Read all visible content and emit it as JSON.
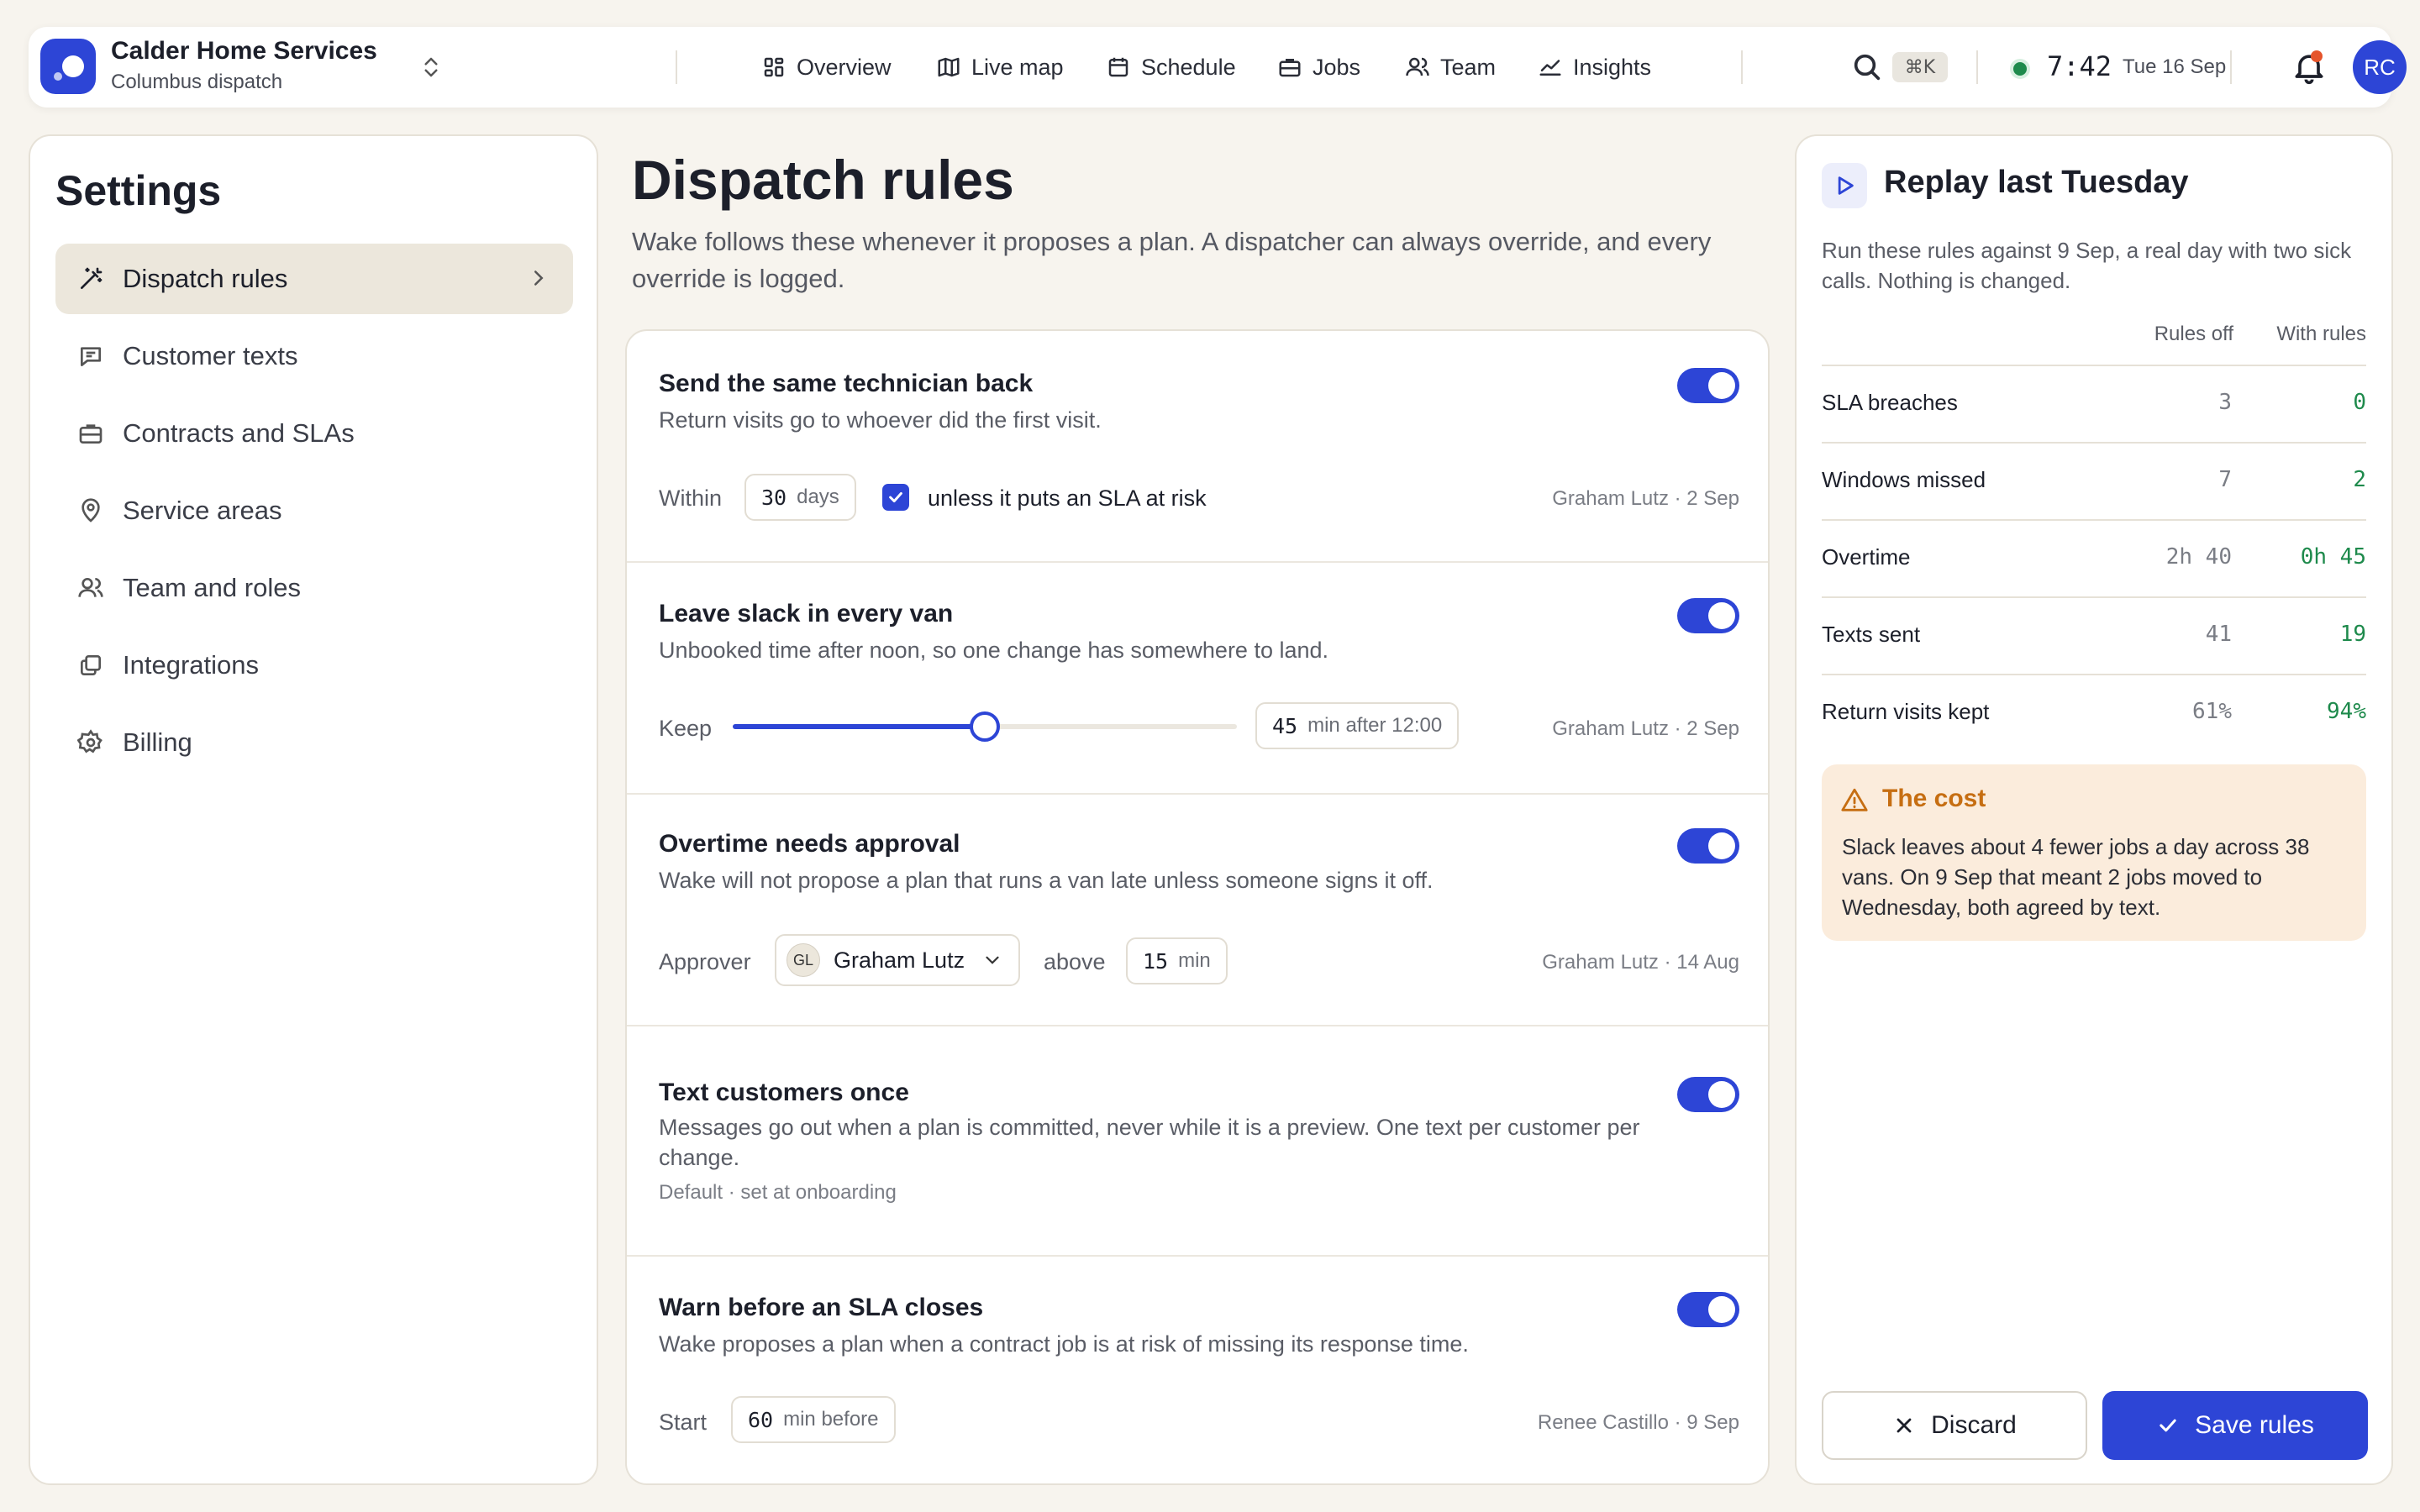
{
  "app": {
    "name": "Calder Home Services",
    "workspace": "Columbus dispatch",
    "nav": [
      {
        "label": "Overview",
        "icon": "grid-icon"
      },
      {
        "label": "Live map",
        "icon": "map-icon"
      },
      {
        "label": "Schedule",
        "icon": "calendar-icon"
      },
      {
        "label": "Jobs",
        "icon": "briefcase-icon"
      },
      {
        "label": "Team",
        "icon": "people-icon"
      },
      {
        "label": "Insights",
        "icon": "trend-icon"
      }
    ],
    "shortcut": "⌘K",
    "clock": "7:42",
    "date": "Tue 16 Sep",
    "user_initials": "RC",
    "accent": "#2d45d6",
    "status_color": "#1e8a4c"
  },
  "sidebar": {
    "title": "Settings",
    "items": [
      {
        "label": "Dispatch rules",
        "icon": "wand-icon",
        "active": true
      },
      {
        "label": "Customer texts",
        "icon": "message-icon"
      },
      {
        "label": "Contracts and SLAs",
        "icon": "briefcase-icon"
      },
      {
        "label": "Service areas",
        "icon": "pin-icon"
      },
      {
        "label": "Team and roles",
        "icon": "people-icon"
      },
      {
        "label": "Integrations",
        "icon": "layers-icon"
      },
      {
        "label": "Billing",
        "icon": "gear-icon"
      }
    ]
  },
  "main": {
    "title": "Dispatch rules",
    "subtitle": "Wake follows these whenever it proposes a plan. A dispatcher can always override, and every override is logged.",
    "rules": [
      {
        "title": "Send the same technician back",
        "desc": "Return visits go to whoever did the first visit.",
        "enabled": true,
        "control_label": "Within",
        "value": "30",
        "unit": "days",
        "checkbox_label": "unless it puts an SLA at risk",
        "checkbox_checked": true,
        "attribution": "Graham Lutz · 2 Sep"
      },
      {
        "title": "Leave slack in every van",
        "desc": "Unbooked time after noon, so one change has somewhere to land.",
        "enabled": true,
        "control_label": "Keep",
        "slider_fraction": 0.5,
        "value": "45",
        "unit": "min after 12:00",
        "attribution": "Graham Lutz · 2 Sep"
      },
      {
        "title": "Overtime needs approval",
        "desc": "Wake will not propose a plan that runs a van late unless someone signs it off.",
        "enabled": true,
        "control_label": "Approver",
        "approver_initials": "GL",
        "approver_name": "Graham Lutz",
        "threshold_label": "above",
        "value": "15",
        "unit": "min",
        "attribution": "Graham Lutz · 14 Aug"
      },
      {
        "title": "Text customers once",
        "desc": "Messages go out when a plan is committed, never while it is a preview. One text per customer per change.",
        "enabled": true,
        "note": "Default · set at onboarding"
      },
      {
        "title": "Warn before an SLA closes",
        "desc": "Wake proposes a plan when a contract job is at risk of missing its response time.",
        "enabled": true,
        "control_label": "Start",
        "value": "60",
        "unit": "min before",
        "attribution": "Renee Castillo · 9 Sep"
      }
    ]
  },
  "replay": {
    "title": "Replay last Tuesday",
    "desc": "Run these rules against 9 Sep, a real day with two sick calls. Nothing is changed.",
    "col_off": "Rules off",
    "col_with": "With rules",
    "rows": [
      {
        "label": "SLA breaches",
        "off": "3",
        "with": "0"
      },
      {
        "label": "Windows missed",
        "off": "7",
        "with": "2"
      },
      {
        "label": "Overtime",
        "off": "2h 40",
        "with": "0h 45"
      },
      {
        "label": "Texts sent",
        "off": "41",
        "with": "19"
      },
      {
        "label": "Return visits kept",
        "off": "61%",
        "with": "94%"
      }
    ],
    "cost_title": "The cost",
    "cost_text": "Slack leaves about 4 fewer jobs a day across 38 vans. On 9 Sep that meant 2 jobs moved to Wednesday, both agreed by text.",
    "discard_label": "Discard",
    "save_label": "Save rules"
  }
}
